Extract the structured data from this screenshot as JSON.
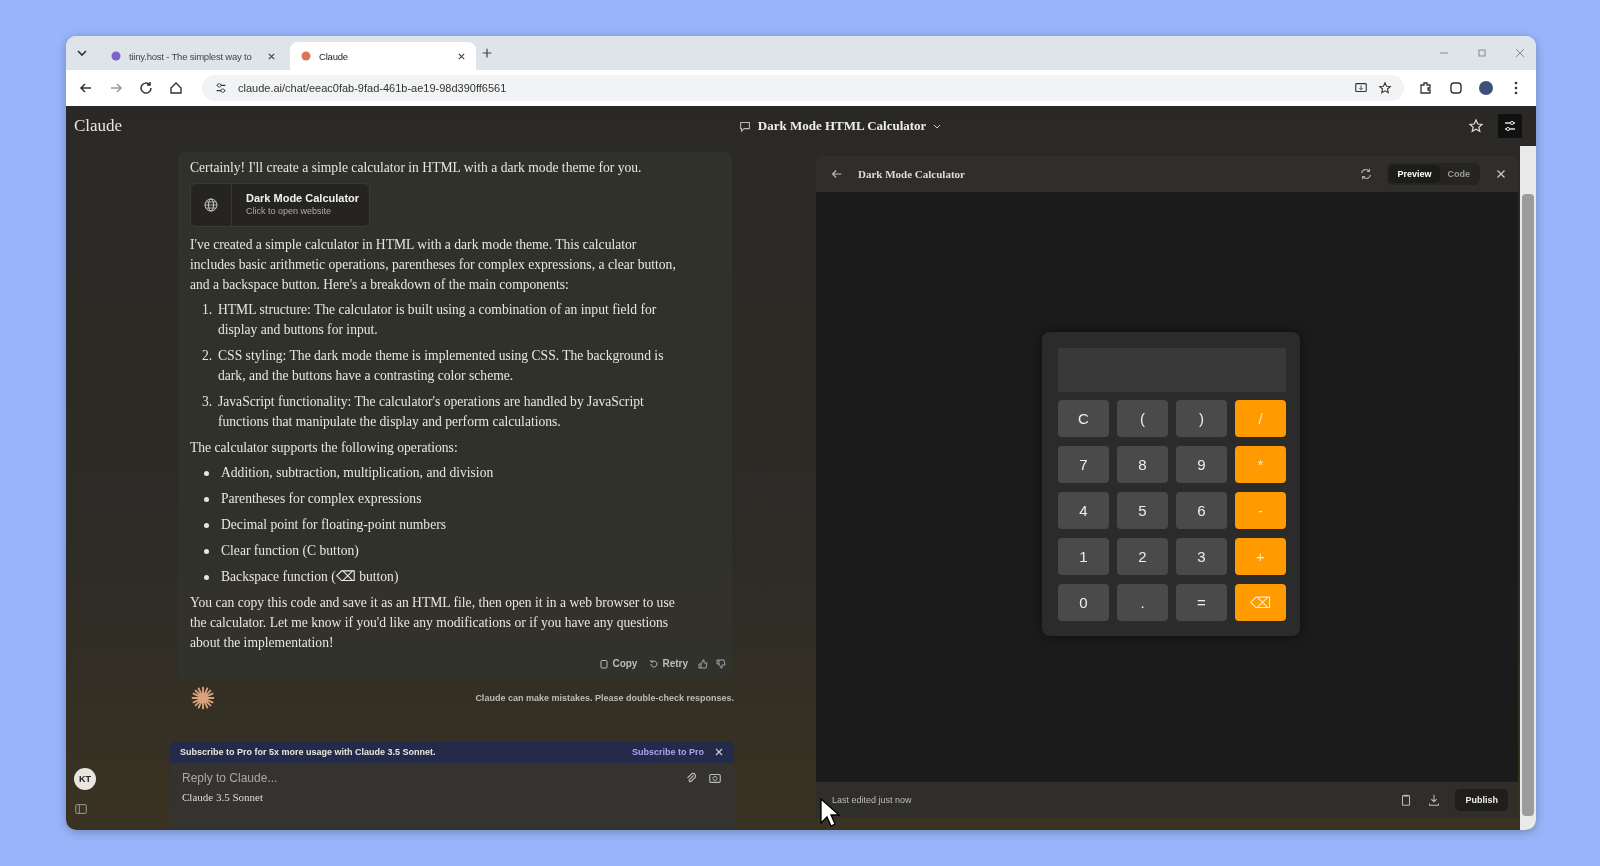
{
  "browser": {
    "tabs": [
      {
        "title": "tiiny.host - The simplest way to",
        "selected": false
      },
      {
        "title": "Claude",
        "selected": true
      }
    ],
    "url": "claude.ai/chat/eeac0fab-9fad-461b-ae19-98d390ff6561"
  },
  "app": {
    "brand": "Claude",
    "chat_title": "Dark Mode HTML Calculator",
    "avatar": "KT"
  },
  "message": {
    "intro": "Certainly! I'll create a simple calculator in HTML with a dark mode theme for you.",
    "artifact_card": {
      "title": "Dark Mode Calculator",
      "subtitle": "Click to open website"
    },
    "paragraph": "I've created a simple calculator in HTML with a dark mode theme. This calculator includes basic arithmetic operations, parentheses for complex expressions, a clear button, and a backspace button. Here's a breakdown of the main components:",
    "numbered": [
      {
        "number": "1.",
        "text": "HTML structure: The calculator is built using a combination of an input field for display and buttons for input."
      },
      {
        "number": "2.",
        "text": "CSS styling: The dark mode theme is implemented using CSS. The background is dark, and the buttons have a contrasting color scheme."
      },
      {
        "number": "3.",
        "text": "JavaScript functionality: The calculator's operations are handled by JavaScript functions that manipulate the display and perform calculations."
      }
    ],
    "supports_heading": "The calculator supports the following operations:",
    "bullets": [
      "Addition, subtraction, multiplication, and division",
      "Parentheses for complex expressions",
      "Decimal point for floating-point numbers",
      "Clear function (C button)",
      "Backspace function (⌫ button)"
    ],
    "closing": "You can copy this code and save it as an HTML file, then open it in a web browser to use the calculator. Let me know if you'd like any modifications or if you have any questions about the implementation!",
    "actions": [
      "Copy",
      "Retry"
    ]
  },
  "disclaimer": "Claude can make mistakes. Please double-check responses.",
  "banner": {
    "text": "Subscribe to Pro for 5x more usage with **Claude 3.5 Sonnet.**",
    "link": "Subscribe to Pro"
  },
  "reply": {
    "placeholder": "Reply to Claude...",
    "model": "Claude 3.5 Sonnet"
  },
  "artifact": {
    "title": "Dark Mode Calculator",
    "tabs": [
      {
        "label": "Preview",
        "selected": true
      },
      {
        "label": "Code",
        "selected": false
      }
    ],
    "keys": [
      {
        "label": "C",
        "kind": "digit"
      },
      {
        "label": "(",
        "kind": "digit"
      },
      {
        "label": ")",
        "kind": "digit"
      },
      {
        "label": "/",
        "kind": "operator"
      },
      {
        "label": "7",
        "kind": "digit"
      },
      {
        "label": "8",
        "kind": "digit"
      },
      {
        "label": "9",
        "kind": "digit"
      },
      {
        "label": "*",
        "kind": "operator"
      },
      {
        "label": "4",
        "kind": "digit"
      },
      {
        "label": "5",
        "kind": "digit"
      },
      {
        "label": "6",
        "kind": "digit"
      },
      {
        "label": "-",
        "kind": "operator"
      },
      {
        "label": "1",
        "kind": "digit"
      },
      {
        "label": "2",
        "kind": "digit"
      },
      {
        "label": "3",
        "kind": "digit"
      },
      {
        "label": "+",
        "kind": "operator"
      },
      {
        "label": "0",
        "kind": "digit"
      },
      {
        "label": ".",
        "kind": "digit"
      },
      {
        "label": "=",
        "kind": "digit"
      },
      {
        "label": "⌫",
        "kind": "operator"
      }
    ],
    "status": "Last edited just now",
    "publish": "Publish"
  }
}
